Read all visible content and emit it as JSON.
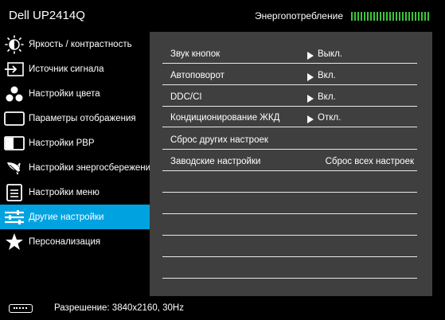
{
  "header": {
    "model": "Dell UP2414Q",
    "energy_label": "Энергопотребление",
    "energy_color": "#3cc43c"
  },
  "sidebar": {
    "active_color": "#00a2e0",
    "items": [
      {
        "label": "Яркость / контрастность",
        "icon": "brightness-icon"
      },
      {
        "label": "Источник сигнала",
        "icon": "input-source-icon"
      },
      {
        "label": "Настройки цвета",
        "icon": "color-settings-icon"
      },
      {
        "label": "Параметры отображения",
        "icon": "display-icon"
      },
      {
        "label": "Настройки PBP",
        "icon": "pbp-icon"
      },
      {
        "label": "Настройки энергосбережения",
        "icon": "energy-leaf-icon"
      },
      {
        "label": "Настройки меню",
        "icon": "menu-settings-icon"
      },
      {
        "label": "Другие настройки",
        "icon": "other-settings-icon",
        "active": true
      },
      {
        "label": "Персонализация",
        "icon": "star-icon"
      }
    ]
  },
  "content": {
    "rows": [
      {
        "label": "Звук кнопок",
        "value": "Выкл."
      },
      {
        "label": "Автоповорот",
        "value": "Вкл."
      },
      {
        "label": "DDC/CI",
        "value": "Вкл."
      },
      {
        "label": "Кондиционирование ЖКД",
        "value": "Откл."
      },
      {
        "label": "Сброс других настроек",
        "value": ""
      },
      {
        "label": "Заводские настройки",
        "value": "Сброс всех настроек"
      }
    ]
  },
  "footer": {
    "icon": "connector-icon",
    "resolution": "Разрешение: 3840x2160, 30Hz"
  }
}
